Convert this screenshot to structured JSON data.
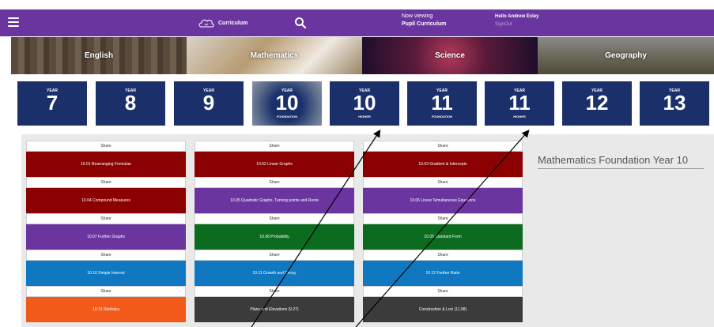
{
  "header": {
    "brand_label": "Curriculum",
    "viewing_label": "Now viewing",
    "viewing_value": "Pupil Curriculum",
    "user_greeting": "Hello Andrew Exley",
    "signout_label": "SignOut"
  },
  "subjects": [
    {
      "label": "English"
    },
    {
      "label": "Mathematics"
    },
    {
      "label": "Science"
    },
    {
      "label": "Geography"
    }
  ],
  "years": [
    {
      "year": "YEAR",
      "num": "7",
      "tier": ""
    },
    {
      "year": "YEAR",
      "num": "8",
      "tier": ""
    },
    {
      "year": "YEAR",
      "num": "9",
      "tier": ""
    },
    {
      "year": "YEAR",
      "num": "10",
      "tier": "FOUNDATION"
    },
    {
      "year": "YEAR",
      "num": "10",
      "tier": "HIGHER"
    },
    {
      "year": "YEAR",
      "num": "11",
      "tier": "FOUNDATION"
    },
    {
      "year": "YEAR",
      "num": "11",
      "tier": "HIGHER"
    },
    {
      "year": "YEAR",
      "num": "12",
      "tier": ""
    },
    {
      "year": "YEAR",
      "num": "13",
      "tier": ""
    }
  ],
  "share_label": "Share",
  "columns": [
    {
      "units": [
        {
          "label": "10.01 Rearranging Formulae",
          "color": "#8b0000"
        },
        {
          "label": "10.04 Compound Measures",
          "color": "#8b0000"
        },
        {
          "label": "10.07 Further Graphs",
          "color": "#6b35a0"
        },
        {
          "label": "10.10 Simple Interest",
          "color": "#0f78c0"
        },
        {
          "label": "10.13 Statistics",
          "color": "#f25a1a"
        }
      ]
    },
    {
      "units": [
        {
          "label": "10.02 Linear Graphs",
          "color": "#8b0000"
        },
        {
          "label": "10.05 Quadratic Graphs, Turning points and Roots",
          "color": "#6b35a0"
        },
        {
          "label": "10.08 Probability",
          "color": "#0b6b1f"
        },
        {
          "label": "10.11 Growth and Decay",
          "color": "#0f78c0"
        },
        {
          "label": "Plans and Elevations (9.27)",
          "color": "#3b3b3b"
        }
      ]
    },
    {
      "units": [
        {
          "label": "10.03 Gradient & Intercepts",
          "color": "#8b0000"
        },
        {
          "label": "10.06 Linear Simultaneous Equations",
          "color": "#6b35a0"
        },
        {
          "label": "10.09 Standard Form",
          "color": "#0b6b1f"
        },
        {
          "label": "10.12 Further Ratio",
          "color": "#0f78c0"
        },
        {
          "label": "Construction & Loci (11.08)",
          "color": "#3b3b3b"
        }
      ]
    }
  ],
  "panel_title": "Mathematics Foundation Year 10"
}
